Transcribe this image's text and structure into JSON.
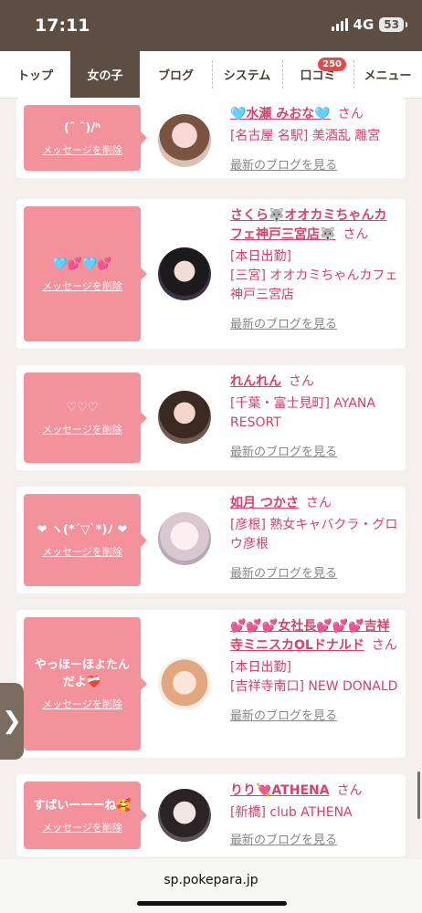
{
  "status": {
    "time": "17:11",
    "network": "4G",
    "battery": "53"
  },
  "nav": {
    "items": [
      {
        "label": "トップ"
      },
      {
        "label": "女の子"
      },
      {
        "label": "ブログ"
      },
      {
        "label": "システム"
      },
      {
        "label": "口コミ",
        "badge": "250"
      },
      {
        "label": "メニュー"
      }
    ],
    "active_index": 1
  },
  "cards": [
    {
      "message": "(ˆ ˆ)/ʰ",
      "delete_label": "メッセージを削除",
      "name": "🩵水瀬 みおな🩵",
      "san": "さん",
      "shop": "[名古屋 名駅] 美酒乱 離宮",
      "blog_label": "最新のブログを見る"
    },
    {
      "message": "🩵💕🩵💕",
      "delete_label": "メッセージを削除",
      "name": "さくら🐺オオカミちゃんカフェ神戸三宮店🐺",
      "san": "さん",
      "shop": "[本日出勤]\n[三宮] オオカミちゃんカフェ神戸三宮店",
      "blog_label": "最新のブログを見る"
    },
    {
      "message": "♡♡♡",
      "delete_label": "メッセージを削除",
      "name": "れんれん",
      "san": "さん",
      "shop": "[千葉・富士見町] AYANA RESORT",
      "blog_label": "最新のブログを見る"
    },
    {
      "message": "❤ ヽ(*´▽`*)ﾉ ❤",
      "delete_label": "メッセージを削除",
      "name": "如月 つかさ",
      "san": "さん",
      "shop": "[彦根] 熟女キャバクラ・グロウ彦根",
      "blog_label": "最新のブログを見る"
    },
    {
      "message": "やっほーほよたんだよ❤️‍🩹",
      "delete_label": "メッセージを削除",
      "name": "💕💕💕女社長💕💕💕吉祥寺ミニスカOLドナルド",
      "san": "さん",
      "shop": "[本日出勤]\n[吉祥寺南口] NEW DONALD",
      "blog_label": "最新のブログを見る"
    },
    {
      "message": "すばいーーーね🥰",
      "delete_label": "メッセージを削除",
      "name": "りり💘ATHENA",
      "san": "さん",
      "shop": "[新橋] club ATHENA",
      "blog_label": "最新のブログを見る"
    }
  ],
  "side_tab": {
    "icon": "chevron-right-icon",
    "glyph": "❯"
  },
  "url_bar": {
    "url": "sp.pokepara.jp"
  },
  "colors": {
    "brand": "#5c4e42",
    "accent": "#d9406a",
    "bubble": "#f4929c",
    "badge": "#e34a4a"
  }
}
